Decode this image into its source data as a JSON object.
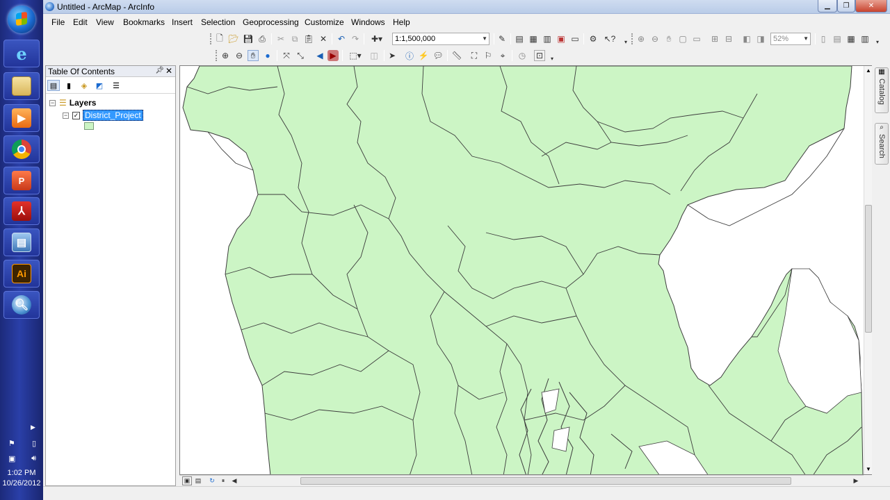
{
  "window": {
    "title": "Untitled - ArcMap - ArcInfo"
  },
  "menu": [
    "File",
    "Edit",
    "View",
    "Bookmarks",
    "Insert",
    "Selection",
    "Geoprocessing",
    "Customize",
    "Windows",
    "Help"
  ],
  "toolbar": {
    "scale": "1:1,500,000",
    "zoom_percent": "52%"
  },
  "toc": {
    "title": "Table Of Contents",
    "root_label": "Layers",
    "layer_label": "District_Project",
    "layer_checked": true,
    "symbol_color": "#ccf5c5"
  },
  "dock_tabs": {
    "catalog": "Catalog",
    "search": "Search"
  },
  "taskbar": {
    "time": "1:02 PM",
    "date": "10/26/2012"
  },
  "map": {
    "fill_color": "#ccf5c5",
    "outline_color": "#3c3c3c",
    "background": "#ffffff"
  }
}
